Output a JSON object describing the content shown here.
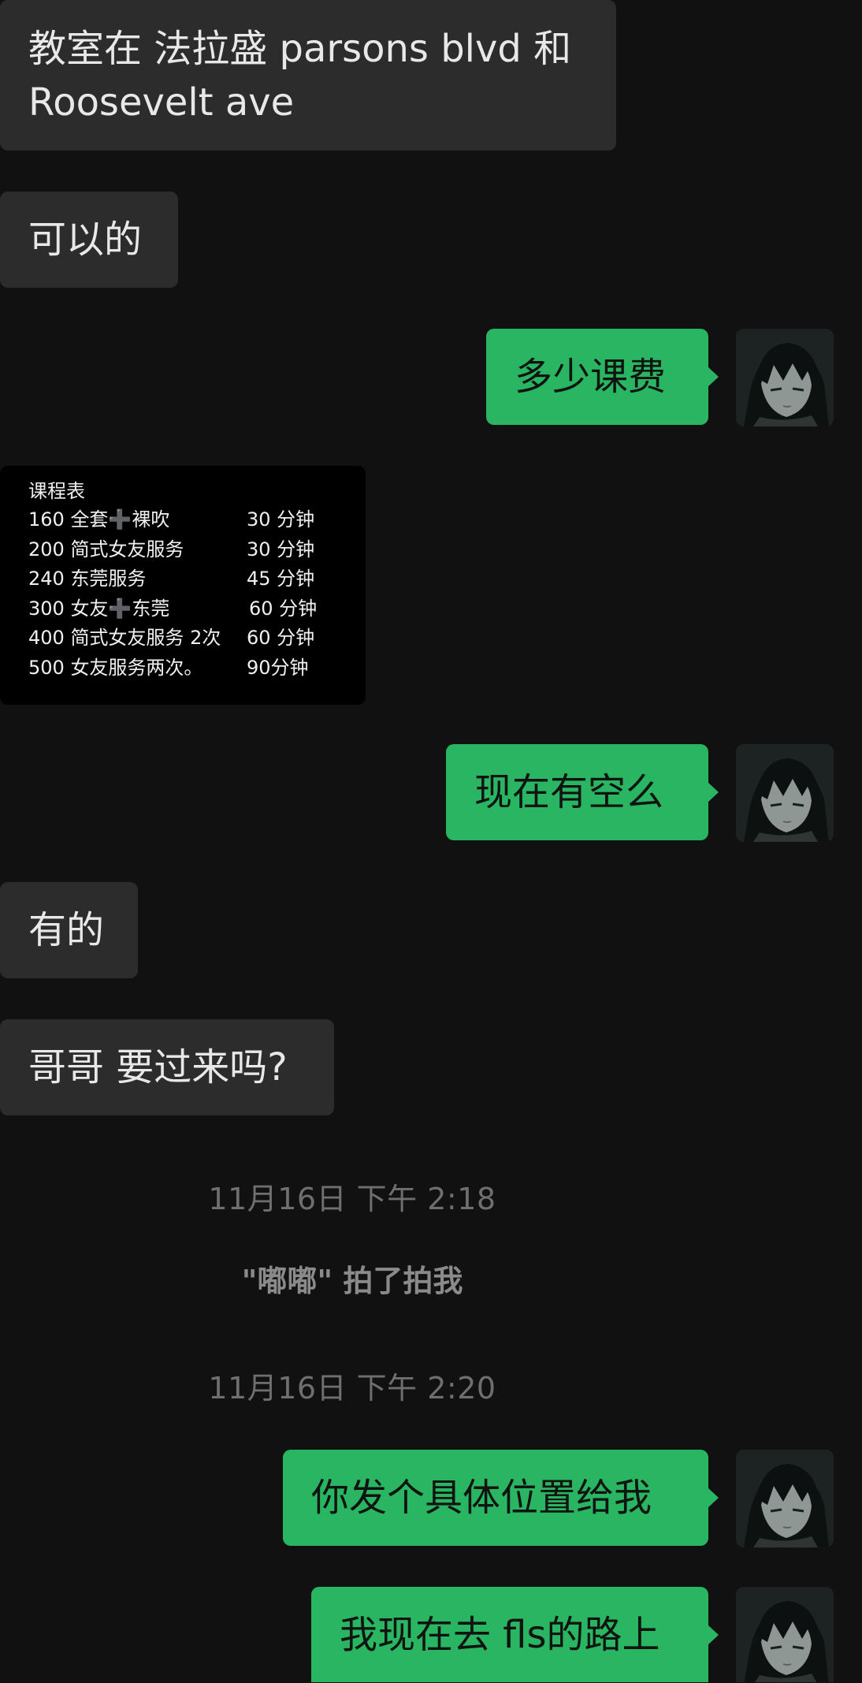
{
  "messages": [
    {
      "text_line1": "教室在 法拉盛 parsons blvd 和",
      "text_line2": "Roosevelt ave"
    },
    {
      "text": "可以的"
    },
    {
      "text": "多少课费"
    },
    {
      "text": "现在有空么"
    },
    {
      "text": "有的"
    },
    {
      "text": "哥哥 要过来吗?"
    },
    {
      "text": "你发个具体位置给我"
    },
    {
      "text": "我现在去 fls的路上"
    }
  ],
  "schedule": {
    "title": "课程表",
    "rows": [
      {
        "item": "160 全套➕裸吹",
        "duration": "30 分钟"
      },
      {
        "item": "200 简式女友服务",
        "duration": "30 分钟"
      },
      {
        "item": "240 东莞服务",
        "duration": "45 分钟"
      },
      {
        "item": "300 女友➕东莞",
        "duration": "60 分钟"
      },
      {
        "item": "400 简式女友服务 2次",
        "duration": "60 分钟"
      },
      {
        "item": "500 女友服务两次。",
        "duration": "90分钟"
      }
    ]
  },
  "timestamps": [
    "11月16日 下午 2:18",
    "11月16日 下午 2:20"
  ],
  "system_notice": "\"嘟嘟\" 拍了拍我",
  "colors": {
    "background": "#111111",
    "incoming_bubble": "#2c2c2c",
    "outgoing_bubble": "#29b561",
    "timestamp_text": "#6f6f6f"
  },
  "icons": {
    "avatar": "anime-character-avatar"
  }
}
